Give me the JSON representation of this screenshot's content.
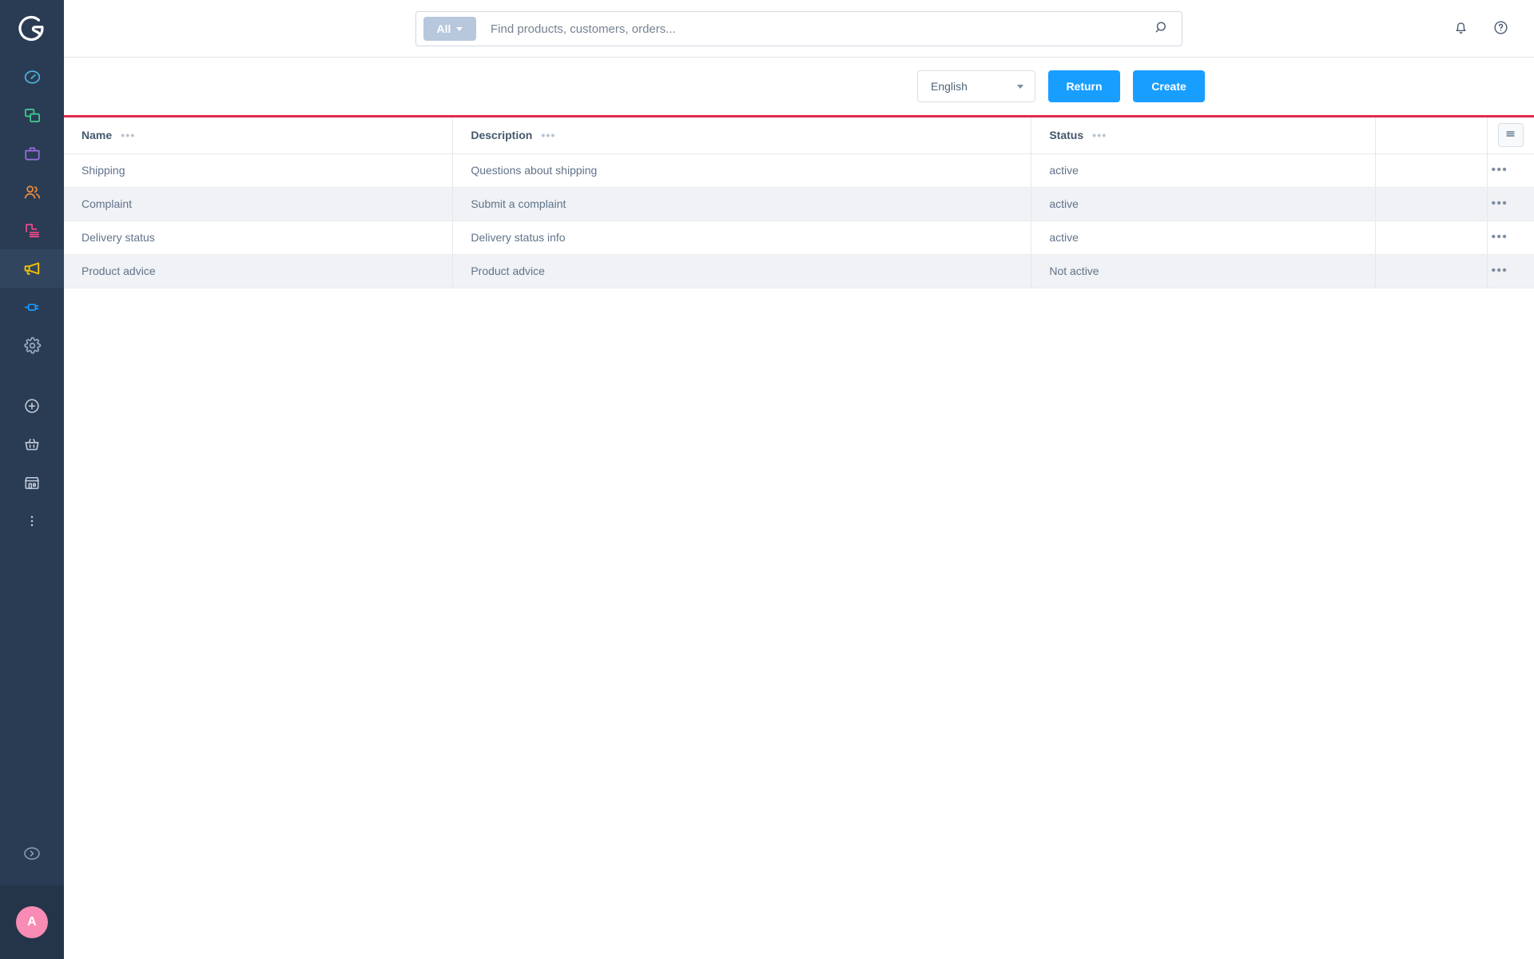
{
  "app": {
    "brand": "shopware",
    "logo_icon": "shopware-logo-icon"
  },
  "sidebar": {
    "items": [
      {
        "label": "Dashboard",
        "icon": "dashboard-gauge-icon",
        "color": "#4db8e8",
        "active": false
      },
      {
        "label": "Catalogues",
        "icon": "copy-layers-icon",
        "color": "#3ecf8e",
        "active": false
      },
      {
        "label": "Orders",
        "icon": "briefcase-bag-icon",
        "color": "#9b6ddf",
        "active": false
      },
      {
        "label": "Customers",
        "icon": "users-group-icon",
        "color": "#f08c3c",
        "active": false
      },
      {
        "label": "Content",
        "icon": "content-page-icon",
        "color": "#ef4a8a",
        "active": false
      },
      {
        "label": "Marketing",
        "icon": "megaphone-icon",
        "color": "#f2c300",
        "active": true
      },
      {
        "label": "Extensions",
        "icon": "plug-connector-icon",
        "color": "#1a9bff",
        "active": false
      },
      {
        "label": "Settings",
        "icon": "gear-icon",
        "color": "#9fb0c4",
        "active": false
      }
    ],
    "secondary_items": [
      {
        "label": "Add",
        "icon": "plus-circle-icon",
        "color": "#c3cdd9"
      },
      {
        "label": "Basket",
        "icon": "shopping-basket-icon",
        "color": "#c3cdd9"
      },
      {
        "label": "Store",
        "icon": "storefront-icon",
        "color": "#c3cdd9"
      },
      {
        "label": "More",
        "icon": "more-vertical-icon",
        "color": "#c3cdd9"
      }
    ],
    "expand": {
      "label": "Expand menu",
      "icon": "chevron-right-circle-icon"
    },
    "user": {
      "initial": "A",
      "avatar_color": "#f88cb4"
    }
  },
  "topbar": {
    "search": {
      "scope_label": "All",
      "scope_icon": "chevron-down-icon",
      "value": "",
      "placeholder": "Find products, customers, orders...",
      "submit_icon": "search-icon"
    },
    "notifications_icon": "bell-icon",
    "help_icon": "question-circle-icon"
  },
  "smartbar": {
    "language": {
      "selected": "English",
      "icon": "chevron-down-icon",
      "options": [
        "English"
      ]
    },
    "return_label": "Return",
    "create_label": "Create"
  },
  "table": {
    "accent_color": "#df294c",
    "columns": [
      {
        "label": "Name",
        "menu_icon": "column-options-icon"
      },
      {
        "label": "Description",
        "menu_icon": "column-options-icon"
      },
      {
        "label": "Status",
        "menu_icon": "column-options-icon"
      },
      {
        "label": "",
        "menu_icon": ""
      }
    ],
    "settings_icon": "list-settings-icon",
    "row_action_icon": "more-horizontal-icon",
    "rows": [
      {
        "name": "Shipping",
        "description": "Questions about shipping",
        "status": "active"
      },
      {
        "name": "Complaint",
        "description": "Submit a complaint",
        "status": "active"
      },
      {
        "name": "Delivery status",
        "description": "Delivery status info",
        "status": "active"
      },
      {
        "name": "Product advice",
        "description": "Product advice",
        "status": "Not active"
      }
    ]
  }
}
